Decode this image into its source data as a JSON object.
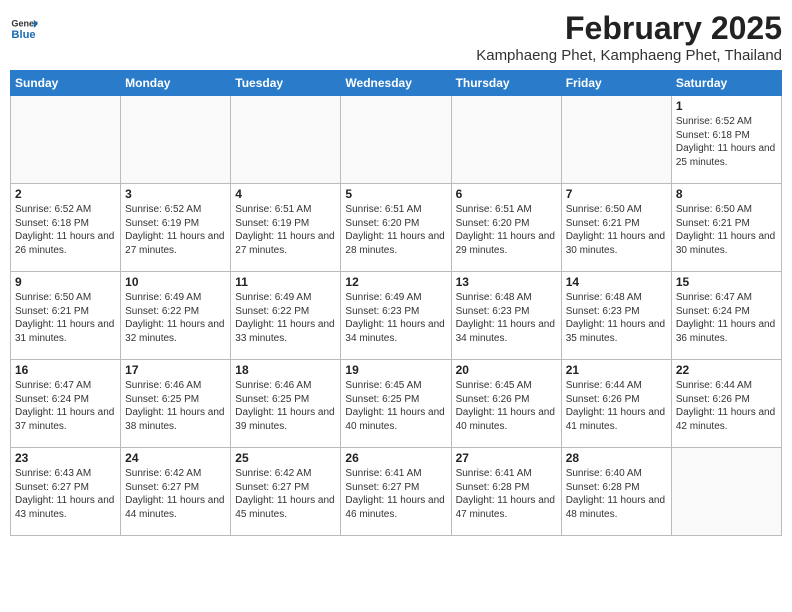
{
  "header": {
    "logo_general": "General",
    "logo_blue": "Blue",
    "title": "February 2025",
    "subtitle": "Kamphaeng Phet, Kamphaeng Phet, Thailand"
  },
  "days_of_week": [
    "Sunday",
    "Monday",
    "Tuesday",
    "Wednesday",
    "Thursday",
    "Friday",
    "Saturday"
  ],
  "weeks": [
    [
      {
        "day": "",
        "info": ""
      },
      {
        "day": "",
        "info": ""
      },
      {
        "day": "",
        "info": ""
      },
      {
        "day": "",
        "info": ""
      },
      {
        "day": "",
        "info": ""
      },
      {
        "day": "",
        "info": ""
      },
      {
        "day": "1",
        "info": "Sunrise: 6:52 AM\nSunset: 6:18 PM\nDaylight: 11 hours and 25 minutes."
      }
    ],
    [
      {
        "day": "2",
        "info": "Sunrise: 6:52 AM\nSunset: 6:18 PM\nDaylight: 11 hours and 26 minutes."
      },
      {
        "day": "3",
        "info": "Sunrise: 6:52 AM\nSunset: 6:19 PM\nDaylight: 11 hours and 27 minutes."
      },
      {
        "day": "4",
        "info": "Sunrise: 6:51 AM\nSunset: 6:19 PM\nDaylight: 11 hours and 27 minutes."
      },
      {
        "day": "5",
        "info": "Sunrise: 6:51 AM\nSunset: 6:20 PM\nDaylight: 11 hours and 28 minutes."
      },
      {
        "day": "6",
        "info": "Sunrise: 6:51 AM\nSunset: 6:20 PM\nDaylight: 11 hours and 29 minutes."
      },
      {
        "day": "7",
        "info": "Sunrise: 6:50 AM\nSunset: 6:21 PM\nDaylight: 11 hours and 30 minutes."
      },
      {
        "day": "8",
        "info": "Sunrise: 6:50 AM\nSunset: 6:21 PM\nDaylight: 11 hours and 30 minutes."
      }
    ],
    [
      {
        "day": "9",
        "info": "Sunrise: 6:50 AM\nSunset: 6:21 PM\nDaylight: 11 hours and 31 minutes."
      },
      {
        "day": "10",
        "info": "Sunrise: 6:49 AM\nSunset: 6:22 PM\nDaylight: 11 hours and 32 minutes."
      },
      {
        "day": "11",
        "info": "Sunrise: 6:49 AM\nSunset: 6:22 PM\nDaylight: 11 hours and 33 minutes."
      },
      {
        "day": "12",
        "info": "Sunrise: 6:49 AM\nSunset: 6:23 PM\nDaylight: 11 hours and 34 minutes."
      },
      {
        "day": "13",
        "info": "Sunrise: 6:48 AM\nSunset: 6:23 PM\nDaylight: 11 hours and 34 minutes."
      },
      {
        "day": "14",
        "info": "Sunrise: 6:48 AM\nSunset: 6:23 PM\nDaylight: 11 hours and 35 minutes."
      },
      {
        "day": "15",
        "info": "Sunrise: 6:47 AM\nSunset: 6:24 PM\nDaylight: 11 hours and 36 minutes."
      }
    ],
    [
      {
        "day": "16",
        "info": "Sunrise: 6:47 AM\nSunset: 6:24 PM\nDaylight: 11 hours and 37 minutes."
      },
      {
        "day": "17",
        "info": "Sunrise: 6:46 AM\nSunset: 6:25 PM\nDaylight: 11 hours and 38 minutes."
      },
      {
        "day": "18",
        "info": "Sunrise: 6:46 AM\nSunset: 6:25 PM\nDaylight: 11 hours and 39 minutes."
      },
      {
        "day": "19",
        "info": "Sunrise: 6:45 AM\nSunset: 6:25 PM\nDaylight: 11 hours and 40 minutes."
      },
      {
        "day": "20",
        "info": "Sunrise: 6:45 AM\nSunset: 6:26 PM\nDaylight: 11 hours and 40 minutes."
      },
      {
        "day": "21",
        "info": "Sunrise: 6:44 AM\nSunset: 6:26 PM\nDaylight: 11 hours and 41 minutes."
      },
      {
        "day": "22",
        "info": "Sunrise: 6:44 AM\nSunset: 6:26 PM\nDaylight: 11 hours and 42 minutes."
      }
    ],
    [
      {
        "day": "23",
        "info": "Sunrise: 6:43 AM\nSunset: 6:27 PM\nDaylight: 11 hours and 43 minutes."
      },
      {
        "day": "24",
        "info": "Sunrise: 6:42 AM\nSunset: 6:27 PM\nDaylight: 11 hours and 44 minutes."
      },
      {
        "day": "25",
        "info": "Sunrise: 6:42 AM\nSunset: 6:27 PM\nDaylight: 11 hours and 45 minutes."
      },
      {
        "day": "26",
        "info": "Sunrise: 6:41 AM\nSunset: 6:27 PM\nDaylight: 11 hours and 46 minutes."
      },
      {
        "day": "27",
        "info": "Sunrise: 6:41 AM\nSunset: 6:28 PM\nDaylight: 11 hours and 47 minutes."
      },
      {
        "day": "28",
        "info": "Sunrise: 6:40 AM\nSunset: 6:28 PM\nDaylight: 11 hours and 48 minutes."
      },
      {
        "day": "",
        "info": ""
      }
    ]
  ]
}
